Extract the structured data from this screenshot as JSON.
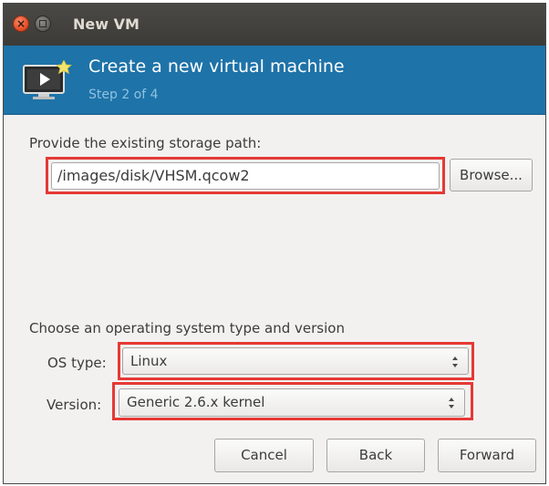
{
  "window": {
    "title": "New VM"
  },
  "header": {
    "title": "Create a new virtual machine",
    "step": "Step 2 of 4"
  },
  "storage": {
    "label": "Provide the existing storage path:",
    "path_value": "/images/disk/VHSM.qcow2",
    "browse_label": "Browse..."
  },
  "os": {
    "section_label": "Choose an operating system type and version",
    "type_label": "OS type:",
    "type_value": "Linux",
    "version_label": "Version:",
    "version_value": "Generic 2.6.x kernel"
  },
  "buttons": {
    "cancel": "Cancel",
    "back": "Back",
    "forward": "Forward"
  },
  "colors": {
    "header_bg": "#1e73a8",
    "highlight": "#e53935",
    "titlebar_bg": "#3c3b37"
  },
  "icons": [
    "close-icon",
    "minimize-icon",
    "virtual-machine-monitor-icon",
    "spin-arrows-icon"
  ]
}
